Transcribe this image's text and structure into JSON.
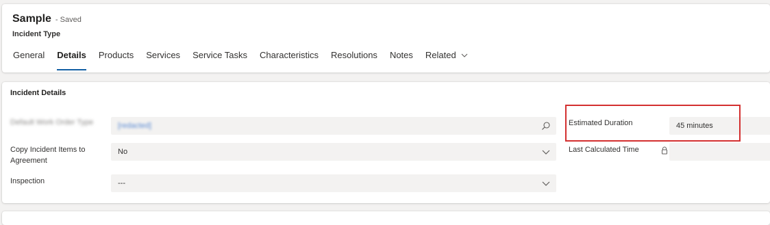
{
  "header": {
    "record_name": "Sample",
    "record_status": "- Saved",
    "entity_type": "Incident Type",
    "tabs": [
      {
        "label": "General"
      },
      {
        "label": "Details"
      },
      {
        "label": "Products"
      },
      {
        "label": "Services"
      },
      {
        "label": "Service Tasks"
      },
      {
        "label": "Characteristics"
      },
      {
        "label": "Resolutions"
      },
      {
        "label": "Notes"
      },
      {
        "label": "Related"
      }
    ],
    "active_tab": "Details"
  },
  "details": {
    "section_title": "Incident Details",
    "fields": {
      "redacted_lookup": {
        "label": "Default Work Order Type",
        "value": "[redacted]"
      },
      "copy_incident_items": {
        "label": "Copy Incident Items to Agreement",
        "value": "No"
      },
      "inspection": {
        "label": "Inspection",
        "value": "---"
      },
      "estimated_duration": {
        "label": "Estimated Duration",
        "value": "45 minutes"
      },
      "last_calculated_time": {
        "label": "Last Calculated Time",
        "value": ""
      }
    }
  },
  "icons": {
    "search": "search-icon",
    "chevron": "chevron-down-icon",
    "lock": "lock-icon"
  },
  "colors": {
    "accent": "#115ea3",
    "highlight": "#d32f2f",
    "field_background": "#f3f2f1"
  }
}
